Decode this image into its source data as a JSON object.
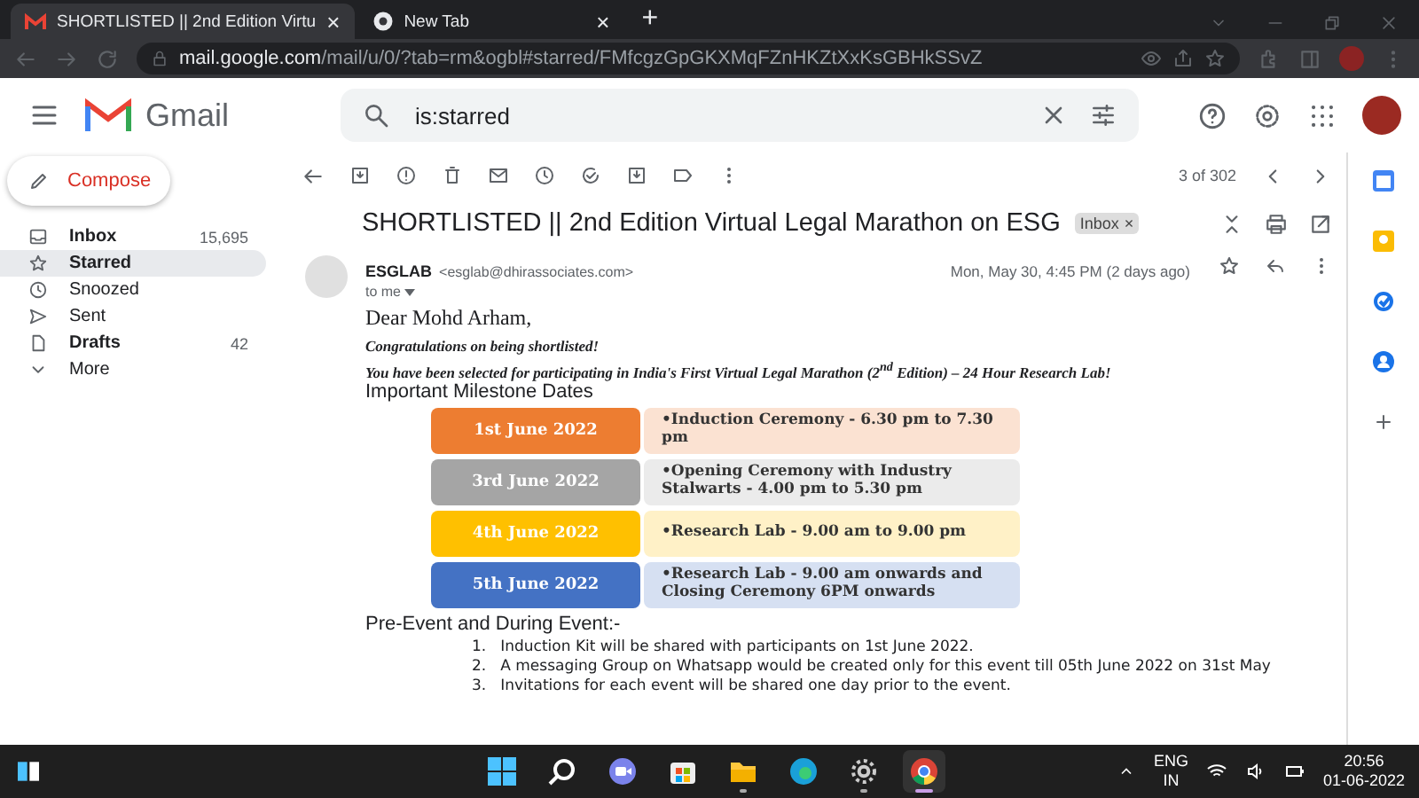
{
  "browser": {
    "tabs": [
      {
        "title": "SHORTLISTED || 2nd Edition Virtu",
        "close": "×",
        "kind": "gmail",
        "selected": true
      },
      {
        "title": "New Tab",
        "close": "×",
        "kind": "chrome",
        "selected": false
      }
    ],
    "new_tab": "+",
    "url_host": "mail.google.com",
    "url_path": "/mail/u/0/?tab=rm&ogbl#starred/FMfcgzGpGKXMqFZnHKZtXxKsGBHkSSvZ"
  },
  "header": {
    "brand": "Gmail",
    "search": {
      "value": "is:starred"
    }
  },
  "sidebar": {
    "compose": "Compose",
    "items": [
      {
        "kind": "inbox",
        "label": "Inbox",
        "count": "15,695",
        "unread": true,
        "selected": false
      },
      {
        "kind": "star",
        "label": "Starred",
        "unread": true,
        "selected": true
      },
      {
        "kind": "clock",
        "label": "Snoozed",
        "unread": false,
        "selected": false
      },
      {
        "kind": "send",
        "label": "Sent",
        "unread": false,
        "selected": false
      },
      {
        "kind": "file",
        "label": "Drafts",
        "count": "42",
        "unread": true,
        "selected": false
      },
      {
        "kind": "chevron",
        "label": "More",
        "unread": false,
        "selected": false
      }
    ]
  },
  "toolbar": {
    "pager": "3 of 302"
  },
  "email": {
    "subject": "SHORTLISTED || 2nd Edition Virtual Legal Marathon on ESG",
    "label": "Inbox",
    "label_close": "×",
    "sender_name": "ESGLAB",
    "sender_email": "<esglab@dhirassociates.com>",
    "recipient": "to me",
    "date": "Mon, May 30, 4:45 PM (2 days ago)",
    "greeting": "Dear Mohd Arham,",
    "congrats": "Congratulations on being shortlisted!",
    "selection": "You have been selected for participating in India's First Virtual Legal Marathon (2$^{nd}$ Edition) – 24 Hour Research Lab!",
    "milestones_heading": "Important Milestone Dates",
    "milestones": [
      {
        "date": "1st June 2022",
        "event": "•Induction Ceremony - 6.30 pm to 7.30 pm",
        "color": "#ed7d31"
      },
      {
        "date": "3rd June 2022",
        "event": "•Opening Ceremony with Industry Stalwarts - 4.00 pm to 5.30 pm",
        "color": "#a5a5a5"
      },
      {
        "date": "4th June 2022",
        "event": "•Research Lab - 9.00 am to 9.00 pm",
        "color": "#ffc000"
      },
      {
        "date": "5th June 2022",
        "event": "•Research Lab - 9.00 am onwards and Closing Ceremony 6PM onwards",
        "color": "#4472c4"
      }
    ],
    "pre_event_heading": "Pre-Event and During Event:-",
    "pre_event_items": [
      {
        "number": "1.",
        "text": "Induction Kit will be shared with participants on 1st June 2022."
      },
      {
        "number": "2.",
        "text": "A messaging Group on Whatsapp would be created only for this event till 05th June 2022 on 31st May"
      },
      {
        "number": "3.",
        "text": "Invitations for each event will be shared one day prior to the event."
      }
    ]
  },
  "taskbar": {
    "apps": [
      {
        "kind": "windows",
        "running": false,
        "selected": false
      },
      {
        "kind": "search",
        "running": false,
        "selected": false
      },
      {
        "kind": "chat",
        "running": false,
        "selected": false
      },
      {
        "kind": "store",
        "running": false,
        "selected": false
      },
      {
        "kind": "folder",
        "running": true,
        "selected": false
      },
      {
        "kind": "edge",
        "running": false,
        "selected": false
      },
      {
        "kind": "gear",
        "running": true,
        "selected": false
      },
      {
        "kind": "chrome",
        "running": true,
        "selected": true
      }
    ],
    "lang": "ENG",
    "region": "IN",
    "time": "20:56",
    "date": "01-06-2022"
  }
}
